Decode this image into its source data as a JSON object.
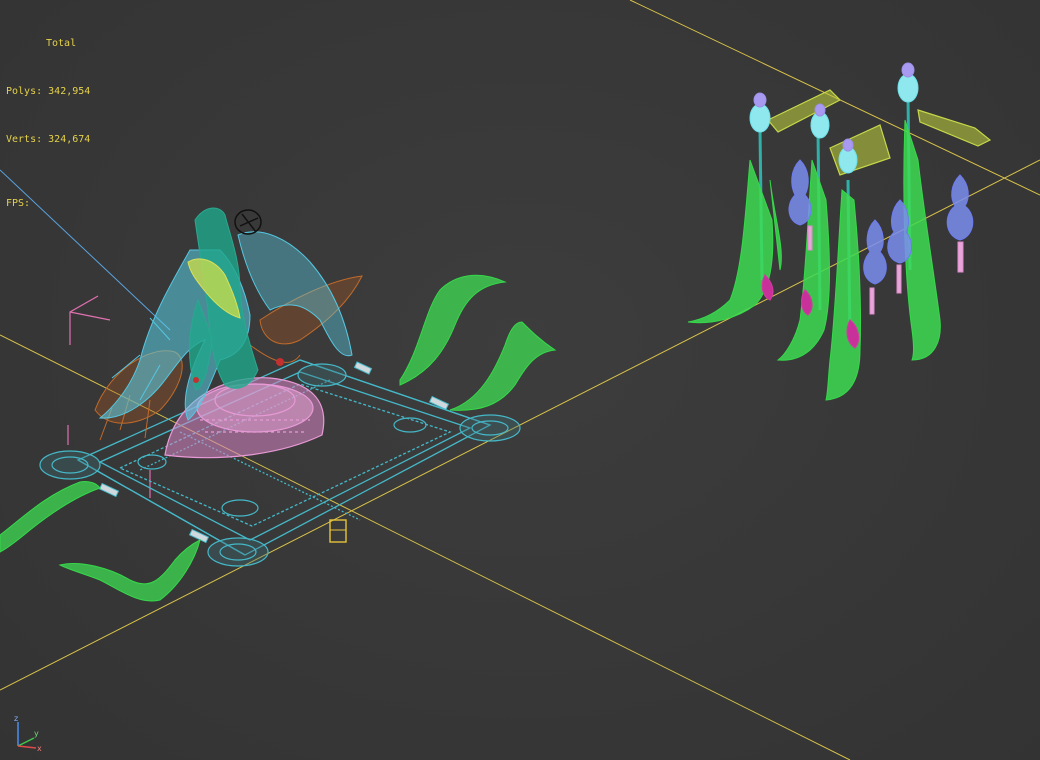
{
  "stats": {
    "title": "Total",
    "polys_label": "Polys:",
    "polys_value": "342,954",
    "verts_label": "Verts:",
    "verts_value": "324,674",
    "fps_label": "FPS:",
    "fps_value": ""
  },
  "gizmo": {
    "axis_z": "z",
    "axis_y": "y",
    "axis_x": "x"
  },
  "colors": {
    "background": "#3a3a3a",
    "grid_line": "#d9c34a",
    "stats_text": "#e6d24a",
    "wire_cyan": "#45b8c8",
    "wire_pink": "#e79ad6",
    "wire_green": "#39d848",
    "wire_orange": "#c06a2a",
    "wire_blue": "#7a8ef0",
    "wire_yellow": "#c6d84a"
  }
}
